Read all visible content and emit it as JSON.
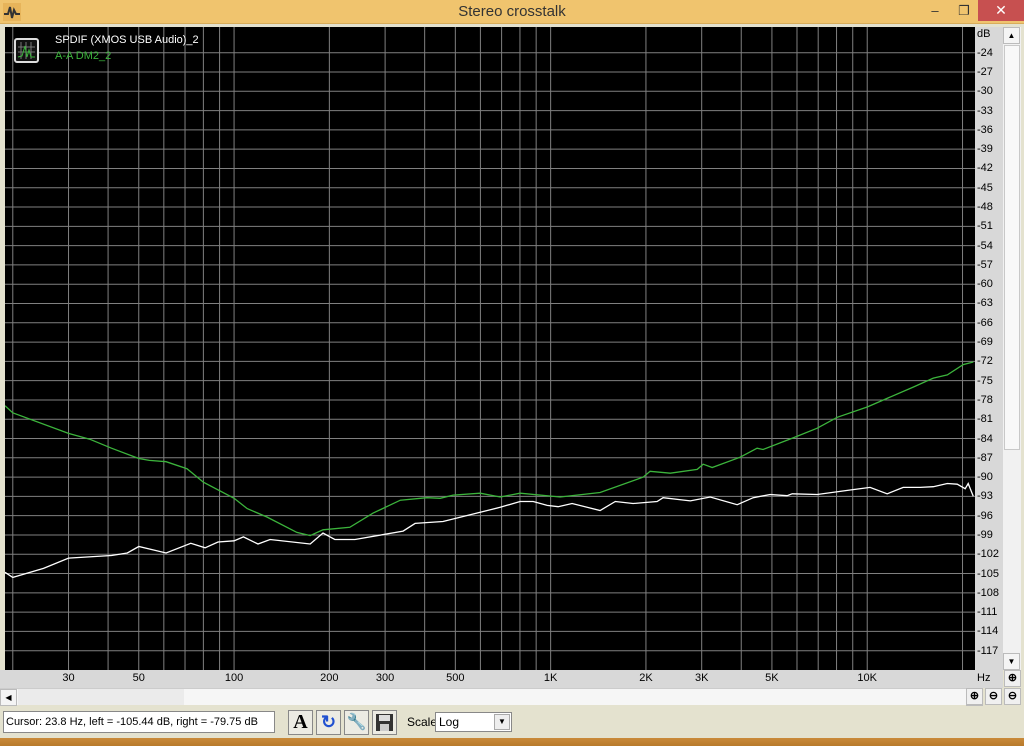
{
  "window": {
    "title": "Stereo crosstalk",
    "minimize": "‒",
    "maximize": "❐",
    "close": "✕"
  },
  "legend": [
    "SPDIF (XMOS USB Audio)_2",
    "A-A DM2_2"
  ],
  "axis": {
    "y_unit": "dB",
    "x_unit": "Hz"
  },
  "status": {
    "cursor_text": "Cursor:  23.8 Hz,  left = -105.44 dB,  right = -79.75 dB",
    "scale_label": "Scale",
    "scale_value": "Log"
  },
  "toolbar_icons": [
    "font-icon",
    "refresh-icon",
    "settings-wrench-icon",
    "save-disk-icon"
  ],
  "colors": {
    "background": "#000000",
    "grid": "#808080",
    "series1": "#ffffff",
    "series2": "#3cb43c",
    "titlebar": "#f0c46e"
  },
  "chart_data": {
    "type": "line",
    "title": "Stereo crosstalk",
    "xlabel": "Hz",
    "ylabel": "dB",
    "xscale": "log",
    "xlim": [
      18.9,
      21900
    ],
    "ylim": [
      -120,
      -20
    ],
    "grid": true,
    "legend_position": "top-left",
    "x_tick_labels": [
      {
        "v": 30,
        "t": "30"
      },
      {
        "v": 50,
        "t": "50"
      },
      {
        "v": 100,
        "t": "100"
      },
      {
        "v": 200,
        "t": "200"
      },
      {
        "v": 300,
        "t": "300"
      },
      {
        "v": 500,
        "t": "500"
      },
      {
        "v": 1000,
        "t": "1K"
      },
      {
        "v": 2000,
        "t": "2K"
      },
      {
        "v": 3000,
        "t": "3K"
      },
      {
        "v": 5000,
        "t": "5K"
      },
      {
        "v": 10000,
        "t": "10K"
      }
    ],
    "y_ticks": [
      -24,
      -27,
      -30,
      -33,
      -36,
      -39,
      -42,
      -45,
      -48,
      -51,
      -54,
      -57,
      -60,
      -63,
      -66,
      -69,
      -72,
      -75,
      -78,
      -81,
      -84,
      -87,
      -90,
      -93,
      -96,
      -99,
      -102,
      -105,
      -108,
      -111,
      -114,
      -117
    ],
    "series": [
      {
        "name": "SPDIF (XMOS USB Audio)_2",
        "color": "#ffffff",
        "x": [
          18.9,
          20,
          25,
          30,
          41,
          46,
          50,
          61,
          73,
          81,
          89,
          100,
          107,
          119,
          130,
          174,
          191,
          208,
          241,
          342,
          373,
          457,
          693,
          801,
          881,
          975,
          1056,
          1169,
          1433,
          1600,
          1822,
          2169,
          2266,
          2761,
          3192,
          3883,
          4364,
          4936,
          5585,
          5794,
          6950,
          8833,
          10214,
          11560,
          12990,
          14690,
          16170,
          17900,
          19240,
          20400,
          20850,
          21630
        ],
        "y": [
          -104.8,
          -105.6,
          -104.2,
          -102.6,
          -102.2,
          -101.8,
          -100.8,
          -101.8,
          -100.3,
          -101.0,
          -100.1,
          -99.9,
          -99.3,
          -100.4,
          -99.7,
          -100.4,
          -98.7,
          -99.7,
          -99.7,
          -98.4,
          -97.2,
          -96.9,
          -94.7,
          -93.8,
          -93.8,
          -94.4,
          -94.6,
          -94.1,
          -95.2,
          -93.8,
          -94.1,
          -93.8,
          -93.2,
          -93.7,
          -93.1,
          -94.3,
          -93.2,
          -92.7,
          -92.9,
          -92.6,
          -92.7,
          -92.0,
          -91.6,
          -92.6,
          -91.6,
          -91.6,
          -91.5,
          -91.0,
          -91.1,
          -91.8,
          -91.0,
          -93.0
        ]
      },
      {
        "name": "A-A DM2_2",
        "color": "#3cb43c",
        "x": [
          18.9,
          20,
          30,
          35,
          41,
          50,
          54,
          61,
          71,
          80,
          100,
          110,
          127,
          158,
          174,
          191,
          232,
          275,
          335,
          407,
          448,
          492,
          599,
          693,
          801,
          1072,
          1433,
          1960,
          2062,
          2388,
          2904,
          3033,
          3238,
          3971,
          4490,
          4690,
          5834,
          6950,
          8036,
          10000,
          13970,
          16170,
          17900,
          20100,
          21630
        ],
        "y": [
          -78.9,
          -80.0,
          -83.2,
          -84.1,
          -85.5,
          -87.1,
          -87.4,
          -87.6,
          -88.7,
          -90.8,
          -93.3,
          -94.9,
          -96.2,
          -98.6,
          -99.1,
          -98.2,
          -97.8,
          -95.6,
          -93.6,
          -93.2,
          -93.3,
          -92.8,
          -92.5,
          -93.1,
          -92.5,
          -93.1,
          -92.4,
          -90.0,
          -89.1,
          -89.4,
          -88.8,
          -88.0,
          -88.5,
          -86.9,
          -85.5,
          -85.7,
          -83.9,
          -82.4,
          -80.7,
          -79.1,
          -76.0,
          -74.6,
          -74.1,
          -72.5,
          -72.1
        ]
      }
    ]
  }
}
